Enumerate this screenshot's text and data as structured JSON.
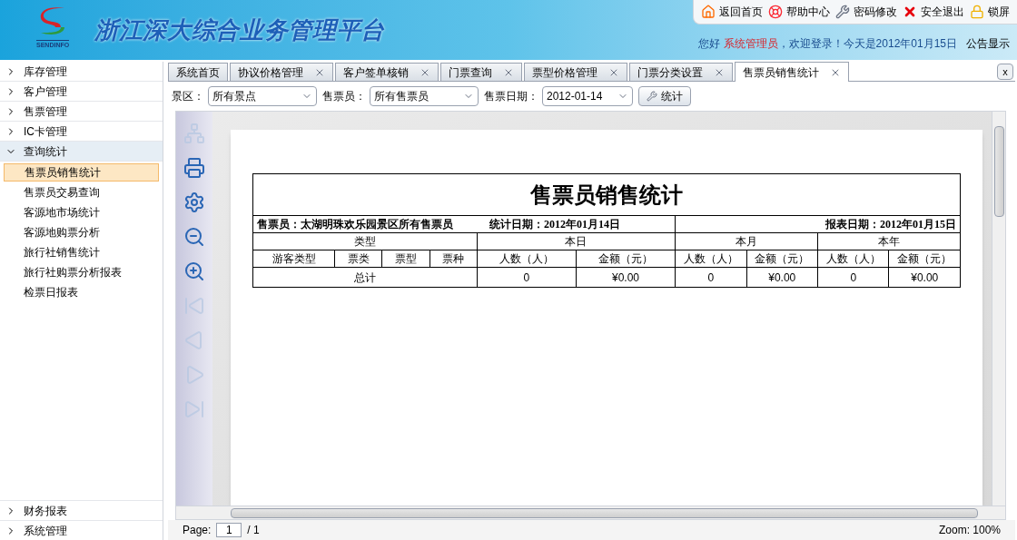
{
  "header": {
    "logo_text": "SENDINFO",
    "title": "浙江深大综合业务管理平台",
    "top_links": [
      {
        "label": "返回首页",
        "kind": "home"
      },
      {
        "label": "帮助中心",
        "kind": "help"
      },
      {
        "label": "密码修改",
        "kind": "tools"
      },
      {
        "label": "安全退出",
        "kind": "exit"
      },
      {
        "label": "锁屏",
        "kind": "lock"
      }
    ],
    "greeting": "您好",
    "user": "系统管理员",
    "welcome": "，欢迎登录！今天是2012年01月15日",
    "notice": "公告显示"
  },
  "sidebar": {
    "items": [
      {
        "label": "库存管理",
        "expanded": false
      },
      {
        "label": "客户管理",
        "expanded": false
      },
      {
        "label": "售票管理",
        "expanded": false
      },
      {
        "label": "IC卡管理",
        "expanded": false
      },
      {
        "label": "查询统计",
        "expanded": true,
        "children": [
          {
            "label": "售票员销售统计",
            "selected": true
          },
          {
            "label": "售票员交易查询",
            "selected": false
          },
          {
            "label": "客源地市场统计",
            "selected": false
          },
          {
            "label": "客源地购票分析",
            "selected": false
          },
          {
            "label": "旅行社销售统计",
            "selected": false
          },
          {
            "label": "旅行社购票分析报表",
            "selected": false
          },
          {
            "label": "检票日报表",
            "selected": false
          }
        ]
      }
    ],
    "bottom_items": [
      {
        "label": "财务报表",
        "expanded": false
      },
      {
        "label": "系统管理",
        "expanded": false
      }
    ]
  },
  "tabs": [
    {
      "label": "系统首页",
      "selected": false,
      "closable": false
    },
    {
      "label": "协议价格管理",
      "selected": false,
      "closable": true
    },
    {
      "label": "客户签单核销",
      "selected": false,
      "closable": true
    },
    {
      "label": "门票查询",
      "selected": false,
      "closable": true
    },
    {
      "label": "票型价格管理",
      "selected": false,
      "closable": true
    },
    {
      "label": "门票分类设置",
      "selected": false,
      "closable": true
    },
    {
      "label": "售票员销售统计",
      "selected": true,
      "closable": true
    }
  ],
  "close_all": "x",
  "filters": [
    {
      "label": "景区：",
      "value": "所有景点"
    },
    {
      "label": "售票员：",
      "value": "所有售票员"
    },
    {
      "label": "售票日期：",
      "value": "2012-01-14"
    }
  ],
  "search_button": "统计",
  "toolbar": [
    {
      "kind": "tree",
      "disabled": true
    },
    {
      "kind": "print",
      "disabled": false
    },
    {
      "kind": "page-setup",
      "disabled": false
    },
    {
      "kind": "zoom-out",
      "disabled": false
    },
    {
      "kind": "zoom-in",
      "disabled": false
    },
    {
      "kind": "first",
      "disabled": true
    },
    {
      "kind": "prev",
      "disabled": true
    },
    {
      "kind": "next",
      "disabled": true
    },
    {
      "kind": "last",
      "disabled": true
    }
  ],
  "report": {
    "title": "售票员销售统计",
    "seller": "售票员：太湖明珠欢乐园景区所有售票员",
    "stat_date": "统计日期：2012年01月14日",
    "report_date": "报表日期：2012年01月15日",
    "type_header": "类型",
    "period_headers": [
      "本日",
      "本月",
      "本年"
    ],
    "type_columns": [
      "游客类型",
      "票类",
      "票型",
      "票种"
    ],
    "measure_columns": [
      "人数（人）",
      "金额（元）",
      "人数（人）",
      "金额（元）",
      "人数（人）",
      "金额（元）"
    ],
    "total_label": "总计",
    "total_values": [
      "0",
      "¥0.00",
      "0",
      "¥0.00",
      "0",
      "¥0.00"
    ]
  },
  "status": {
    "page_label": "Page:",
    "page_value": "1",
    "page_total": "/ 1",
    "zoom": "Zoom: 100%"
  }
}
